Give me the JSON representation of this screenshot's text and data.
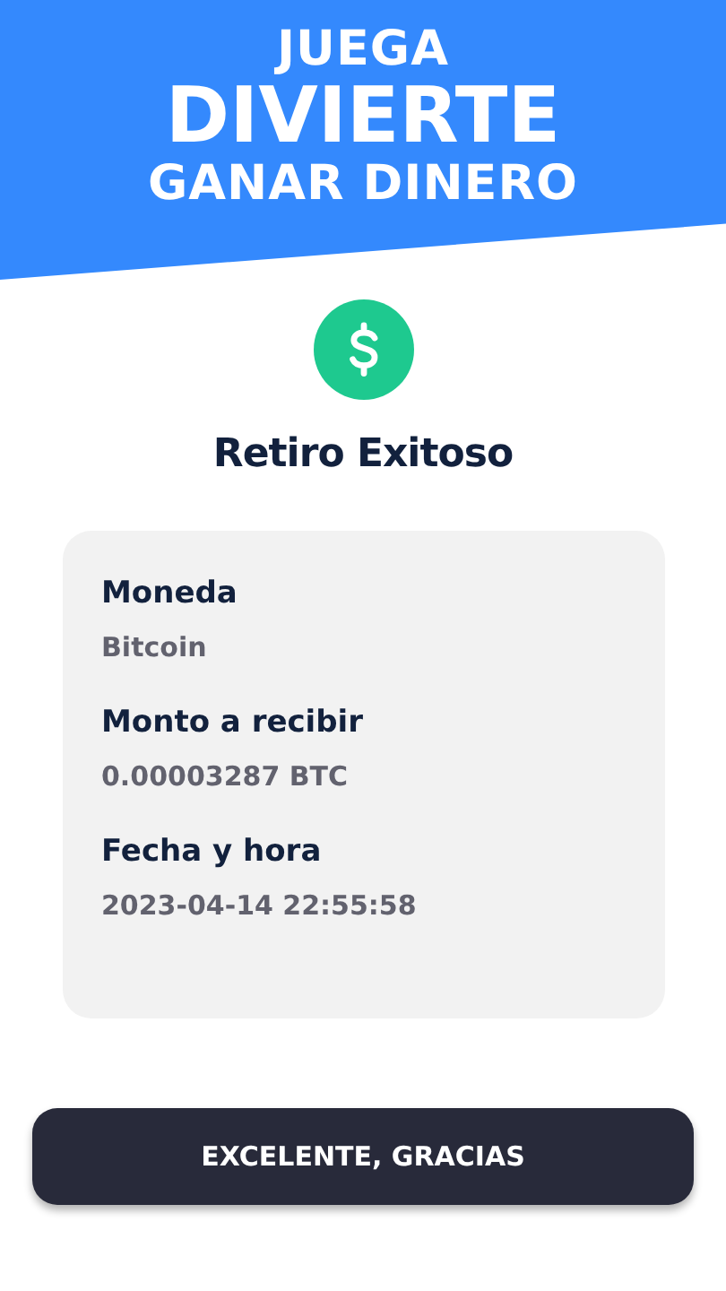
{
  "banner": {
    "lines": [
      "JUEGA",
      "DIVIERTE",
      "GANAR DINERO"
    ]
  },
  "title": "Retiro Exitoso",
  "details": [
    {
      "label": "Moneda",
      "value": "Bitcoin"
    },
    {
      "label": "Monto a recibir",
      "value": "0.00003287 BTC"
    },
    {
      "label": "Fecha y hora",
      "value": "2023-04-14 22:55:58"
    }
  ],
  "button": "EXCELENTE, GRACIAS"
}
